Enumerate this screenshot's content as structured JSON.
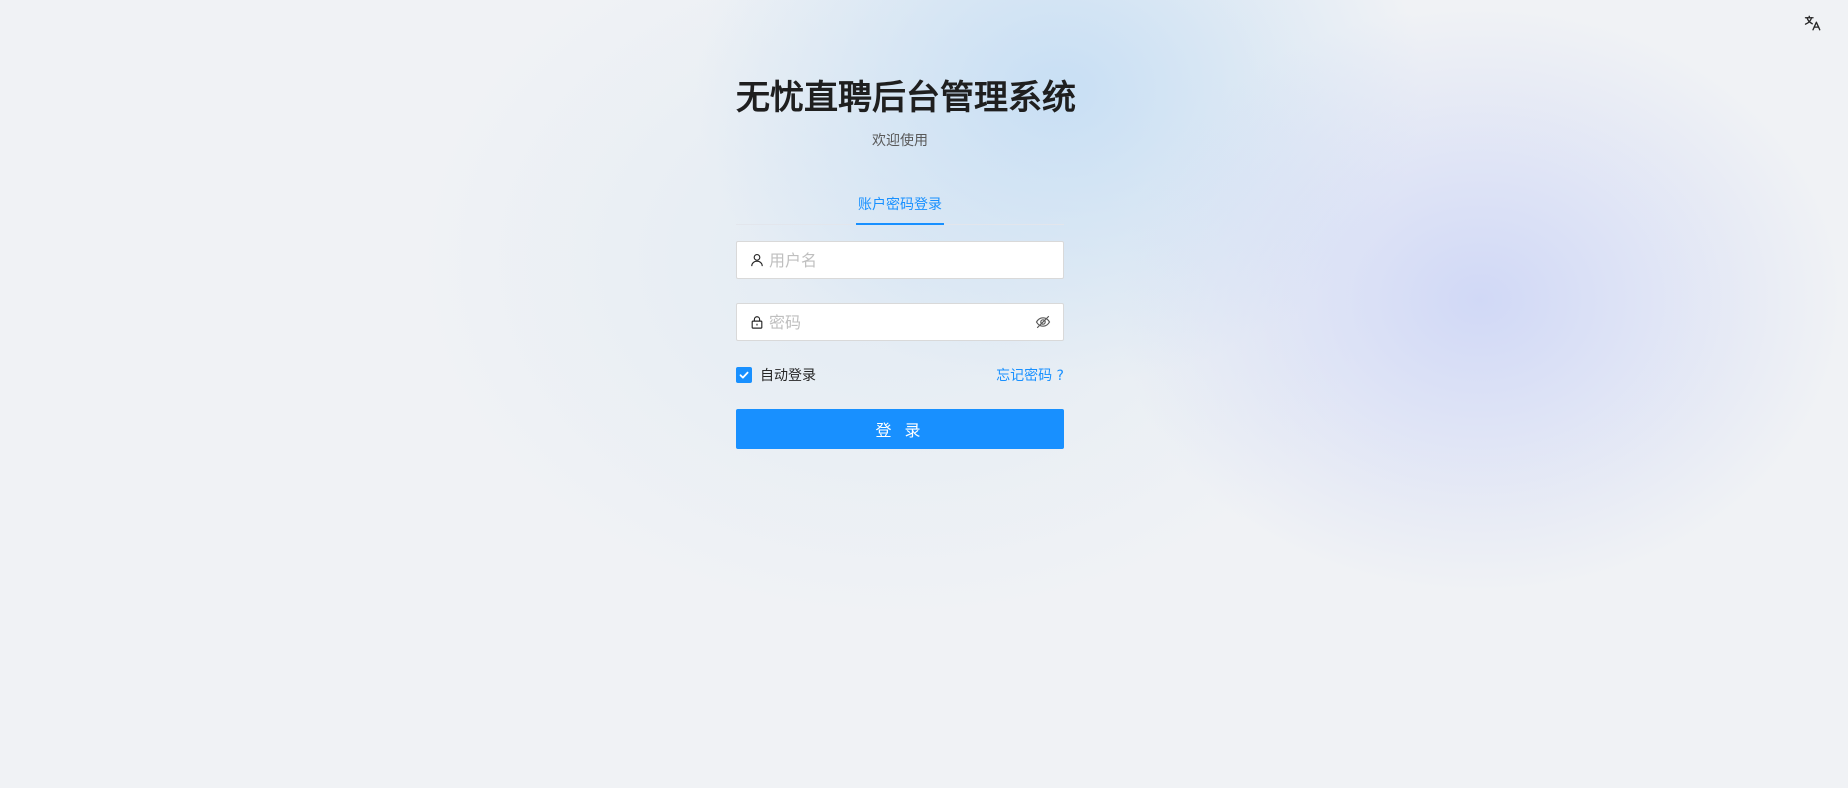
{
  "header": {
    "language_icon": "translate-icon"
  },
  "login": {
    "title": "无忧直聘后台管理系统",
    "subtitle": "欢迎使用",
    "tabs": [
      {
        "label": "账户密码登录",
        "active": true
      }
    ],
    "username": {
      "icon": "user-icon",
      "placeholder": "用户名",
      "value": ""
    },
    "password": {
      "icon": "lock-icon",
      "placeholder": "密码",
      "value": "",
      "toggle_icon": "eye-invisible-icon"
    },
    "auto_login": {
      "label": "自动登录",
      "checked": true
    },
    "forgot_password": "忘记密码 ?",
    "submit_label": "登 录"
  },
  "colors": {
    "primary": "#1890ff",
    "background": "#f0f2f5",
    "title": "#1f1f1f",
    "placeholder": "#bfbfbf"
  }
}
